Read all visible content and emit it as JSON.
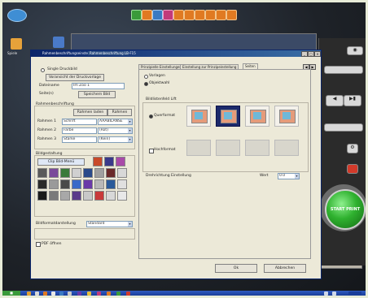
{
  "dialog": {
    "title": "Rahmenbeschriftungseinstellung",
    "doc_tab": "Rahmenbeschriftung  LB-F15"
  },
  "left": {
    "single_title": "Single Druckbild",
    "print_preview_btn": "Voransicht der Druckvorlage",
    "name_label": "Dateiname",
    "name_value": "Im Zoo 1",
    "page_label": "Seite(n)",
    "delete_btn": "Speichern Bild",
    "frame_group": "Rahmenbeschriftung",
    "load_frame_btn": "Rahmen laden",
    "frame_btn": "Rahmen",
    "rows": [
      {
        "label": "Rahmen 1",
        "field": "Schrift",
        "value": "AAABILANSE"
      },
      {
        "label": "Rahmen 2",
        "field": "Farbe",
        "value": "(Rot)"
      },
      {
        "label": "Rahmen 3",
        "field": "Stärke",
        "value": "(Kein)"
      }
    ],
    "image_group": "Bildgestaltung",
    "clip_button": "Clip Bild-Menü",
    "format_label": "Bildformatdarstellung",
    "format_value": "Standard",
    "pdf_label": "PDF öffnen"
  },
  "tabs": [
    {
      "label": "Prinzipielle Einstellungen"
    },
    {
      "label": "Einstellung zur Prinzipeinstellung"
    },
    {
      "label": "Seiten"
    }
  ],
  "panel": {
    "radio_a": "Vorlagen",
    "radio_b": "Objektwahl",
    "layout_label": "Bildlistenfeld   Lift",
    "option_a": "Querformat",
    "option_b": "Hochformat",
    "rotation_label": "Drehrichtung Einstellung",
    "unit_label": "Wert",
    "unit_value": "0.0",
    "ok_btn": "Ok",
    "cancel_btn": "Abbrechen"
  },
  "desktop": {
    "icon1_label": "Spiele",
    "icon2_label": "Daten"
  },
  "right_panel": {
    "green_button": "START PRINT"
  },
  "colors": {
    "title_blue": "#0a246a",
    "dialog_bg": "#ece9d8",
    "selected_thumb": "#1c2a6b",
    "green": "#2fb12f"
  }
}
